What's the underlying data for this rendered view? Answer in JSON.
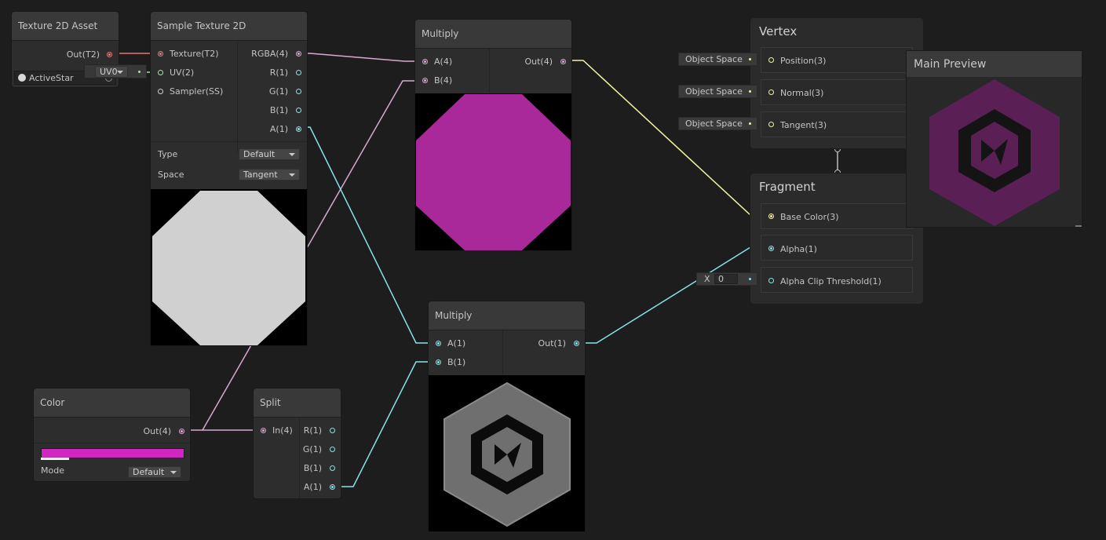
{
  "colors": {
    "background": "#1d1d1d",
    "node": "#2d2d2d",
    "title_bar": "#393939",
    "magenta": "#a9289a",
    "color_swatch": "#d226c2",
    "wire_texture": "#e27a7a",
    "wire_vector4": "#d7a8d0",
    "wire_float": "#84e4e7",
    "wire_vector2": "#a4e6a4",
    "wire_vector3": "#f4f3a1"
  },
  "texture_asset": {
    "title": "Texture 2D Asset",
    "out_label": "Out(T2)",
    "asset_name": "ActiveStar",
    "asset_icon": "texture-asset-icon"
  },
  "sample_texture": {
    "title": "Sample Texture 2D",
    "inputs": [
      "Texture(T2)",
      "UV(2)",
      "Sampler(SS)"
    ],
    "outputs": [
      "RGBA(4)",
      "R(1)",
      "G(1)",
      "B(1)",
      "A(1)"
    ],
    "uv_chip": "UV0",
    "type_label": "Type",
    "type_value": "Default",
    "space_label": "Space",
    "space_value": "Tangent"
  },
  "multiply_top": {
    "title": "Multiply",
    "inputs": [
      "A(4)",
      "B(4)"
    ],
    "output": "Out(4)"
  },
  "multiply_bottom": {
    "title": "Multiply",
    "inputs": [
      "A(1)",
      "B(1)"
    ],
    "output": "Out(1)"
  },
  "color_node": {
    "title": "Color",
    "output": "Out(4)",
    "mode_label": "Mode",
    "mode_value": "Default"
  },
  "split_node": {
    "title": "Split",
    "input": "In(4)",
    "outputs": [
      "R(1)",
      "G(1)",
      "B(1)",
      "A(1)"
    ]
  },
  "vertex": {
    "title": "Vertex",
    "slots": [
      "Position(3)",
      "Normal(3)",
      "Tangent(3)"
    ],
    "chips": [
      "Object Space",
      "Object Space",
      "Object Space"
    ]
  },
  "fragment": {
    "title": "Fragment",
    "slots": [
      "Base Color(3)",
      "Alpha(1)",
      "Alpha Clip Threshold(1)"
    ],
    "clip_axis": "X",
    "clip_value": "0"
  },
  "main_preview": {
    "title": "Main Preview"
  }
}
